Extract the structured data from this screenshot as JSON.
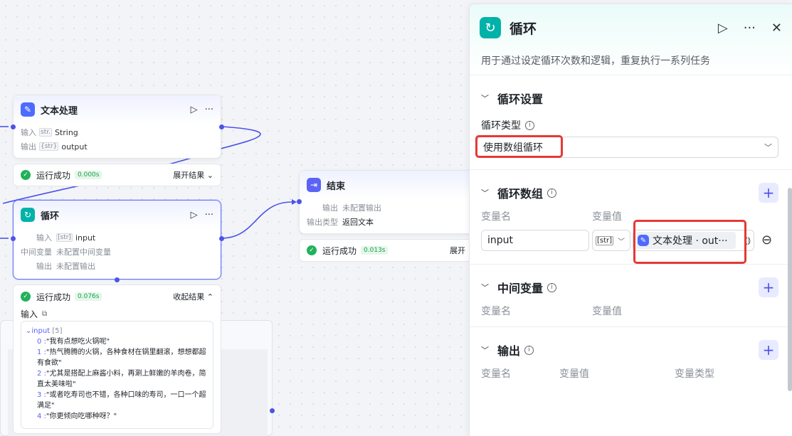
{
  "nodes": {
    "text_process": {
      "title": "文本处理",
      "input_label": "输入",
      "input_type_tag": "str.",
      "input_value": "String",
      "output_label": "输出",
      "output_type_tag": "{str}",
      "output_value": "output",
      "status": "运行成功",
      "time": "0.000s",
      "expand": "展开结果 ⌄"
    },
    "loop": {
      "title": "循环",
      "input_label": "输入",
      "input_type_tag": "[str]",
      "input_value": "input",
      "mid_label": "中间变量",
      "mid_value": "未配置中间变量",
      "output_label": "输出",
      "output_value": "未配置输出",
      "status": "运行成功",
      "time": "0.076s",
      "collapse": "收起结果 ⌃",
      "detail_title": "输入",
      "code_key": "input",
      "code_count": "[5]",
      "items": [
        {
          "idx": "0 :",
          "text": "\"我有点想吃火锅呢\""
        },
        {
          "idx": "1 :",
          "text": "\"热气腾腾的火锅，各种食材在锅里翻滚，想想都超有食欲\""
        },
        {
          "idx": "2 :",
          "text": "\"尤其是搭配上麻酱小料，再涮上鲜嫩的羊肉卷，简直太美味啦\""
        },
        {
          "idx": "3 :",
          "text": "\"或者吃寿司也不错，各种口味的寿司，一口一个超满足\""
        },
        {
          "idx": "4 :",
          "text": "\"你更倾向吃哪种呀？\""
        }
      ]
    },
    "end": {
      "title": "结束",
      "output_label": "输出",
      "output_value": "未配置输出",
      "output_type_label": "输出类型",
      "output_type_value": "返回文本",
      "status": "运行成功",
      "time": "0.013s",
      "expand": "展开"
    }
  },
  "panel": {
    "title": "循环",
    "description": "用于通过设定循环次数和逻辑，重复执行一系列任务",
    "loop_settings": {
      "title": "循环设置",
      "type_label": "循环类型",
      "type_value": "使用数组循环"
    },
    "loop_array": {
      "title": "循环数组",
      "col_name": "变量名",
      "col_value": "变量值",
      "var_name": "input",
      "var_type": "[str]",
      "ref_value": "文本处理 · out···"
    },
    "mid_vars": {
      "title": "中间变量",
      "col_name": "变量名",
      "col_value": "变量值"
    },
    "output": {
      "title": "输出",
      "col_name": "变量名",
      "col_value": "变量值",
      "col_type": "变量类型"
    }
  },
  "colors": {
    "accent": "#4d53e8",
    "teal": "#00b2a9",
    "success": "#20b25b",
    "highlight": "#e53935"
  }
}
